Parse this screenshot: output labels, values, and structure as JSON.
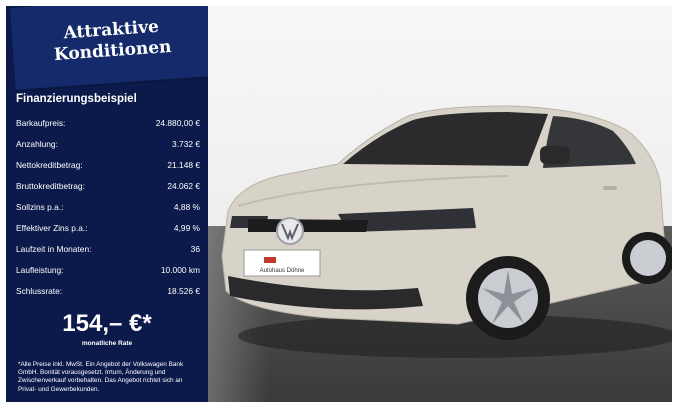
{
  "promo": {
    "headline_line1": "Attraktive",
    "headline_line2": "Konditionen"
  },
  "finance": {
    "title": "Finanzierungsbeispiel",
    "rows": [
      {
        "label": "Barkaufpreis:",
        "value": "24.880,00 €"
      },
      {
        "label": "Anzahlung:",
        "value": "3.732 €"
      },
      {
        "label": "Nettokreditbetrag:",
        "value": "21.148 €"
      },
      {
        "label": "Bruttokreditbetrag:",
        "value": "24.062 €"
      },
      {
        "label": "Sollzins p.a.:",
        "value": "4,88 %"
      },
      {
        "label": "Effektiver Zins p.a.:",
        "value": "4,99 %"
      },
      {
        "label": "Laufzeit in Monaten:",
        "value": "36"
      },
      {
        "label": "Laufleistung:",
        "value": "10.000 km"
      },
      {
        "label": "Schlussrate:",
        "value": "18.526 €"
      }
    ],
    "monthly_price": "154,– €*",
    "monthly_label": "monatliche Rate",
    "disclaimer": "*Alle Preise inkl. MwSt. Ein Angebot der Volkswagen Bank GmbH. Bonität vorausgesetzt. Irrtum, Änderung und Zwischenverkauf vorbehalten. Das Angebot richtet sich an Privat- und Gewerbekunden."
  },
  "vehicle": {
    "license_plate_text": "Autohaus Döhne"
  },
  "colors": {
    "panel_bg": "#0b1a4a",
    "ribbon_bg": "#142a6a",
    "car_body": "#d8d3c8",
    "floor": "#4a4a4a"
  }
}
